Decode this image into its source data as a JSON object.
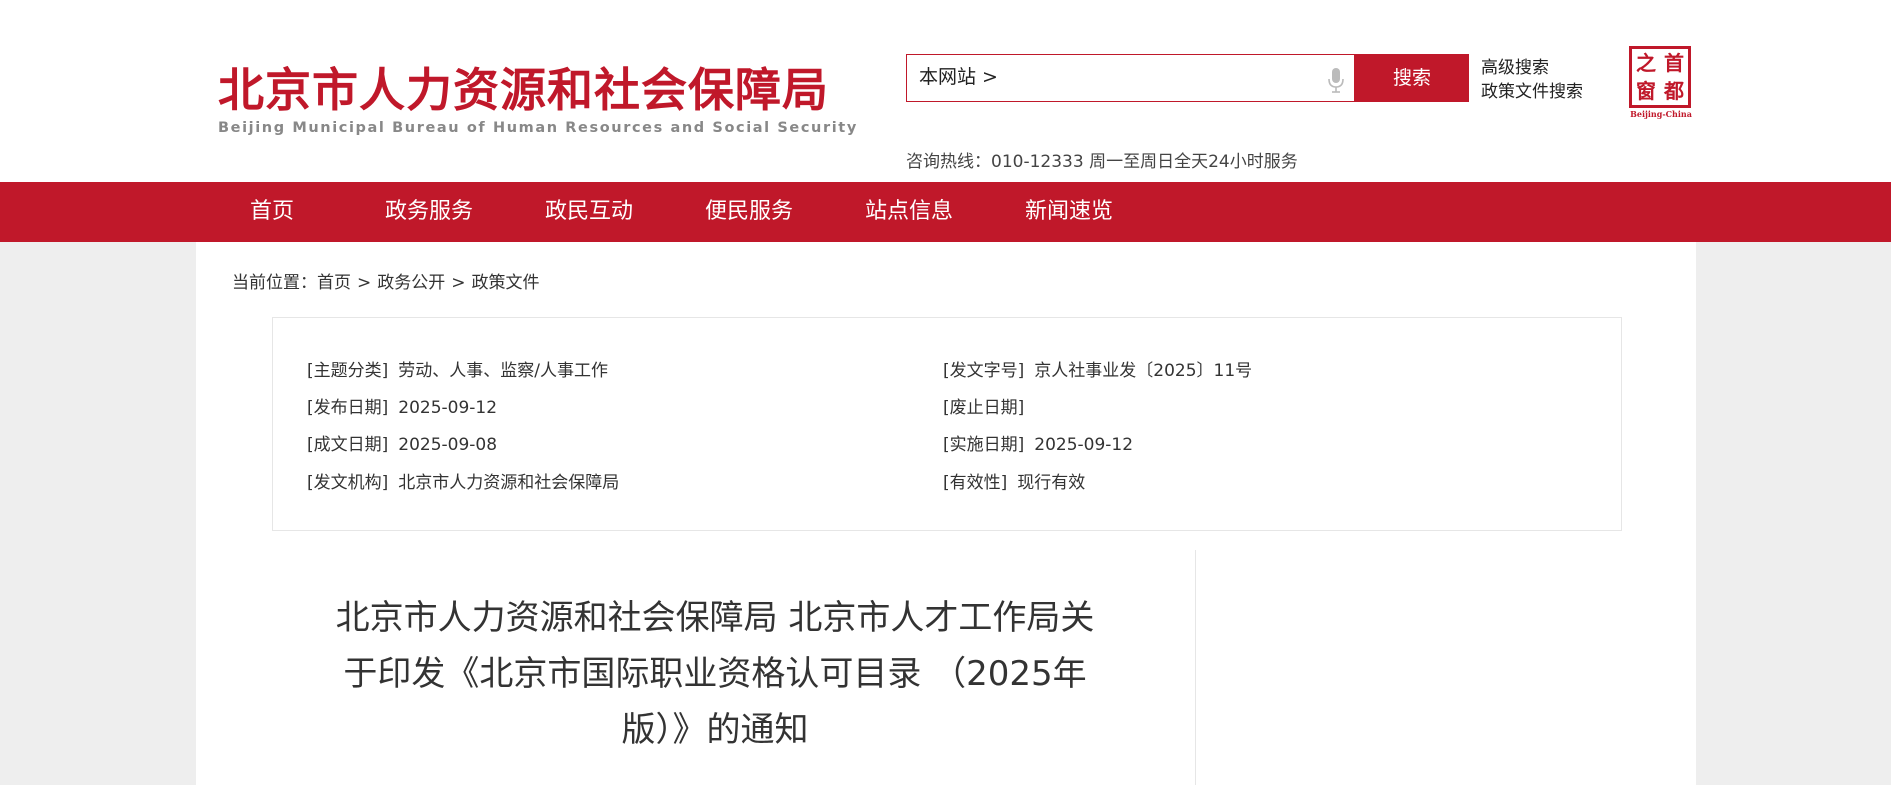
{
  "header": {
    "logo_cn": "北京市人力资源和社会保障局",
    "logo_en": "Beijing Municipal Bureau of Human Resources and Social Security",
    "search_scope": "本网站 >",
    "search_button": "搜索",
    "advanced_search": "高级搜索",
    "policy_search": "政策文件搜索",
    "hotline": "咨询热线：010-12333 周一至周日全天24小时服务",
    "seal": {
      "chars": [
        "首",
        "都",
        "之",
        "窗"
      ],
      "en": "Beijing-China"
    }
  },
  "nav": {
    "items": [
      "首页",
      "政务服务",
      "政民互动",
      "便民服务",
      "站点信息",
      "新闻速览"
    ]
  },
  "breadcrumb": {
    "label": "当前位置：",
    "items": [
      "首页",
      "政务公开",
      "政策文件"
    ],
    "separator": ">"
  },
  "meta": {
    "left": [
      {
        "key": "[主题分类]",
        "value": "劳动、人事、监察/人事工作"
      },
      {
        "key": "[发布日期]",
        "value": "2025-09-12"
      },
      {
        "key": "[成文日期]",
        "value": "2025-09-08"
      },
      {
        "key": "[发文机构]",
        "value": "北京市人力资源和社会保障局"
      }
    ],
    "right": [
      {
        "key": "[发文字号]",
        "value": "京人社事业发〔2025〕11号"
      },
      {
        "key": "[废止日期]",
        "value": ""
      },
      {
        "key": "[实施日期]",
        "value": "2025-09-12"
      },
      {
        "key": "[有效性]",
        "value": "现行有效"
      }
    ]
  },
  "article": {
    "title_lines": [
      "北京市人力资源和社会保障局 北京市人才工作局关",
      "于印发《北京市国际职业资格认可目录 （2025年",
      "版）》的通知"
    ]
  },
  "colors": {
    "brand_red": "#c0182a",
    "page_bg": "#eeeeee"
  }
}
